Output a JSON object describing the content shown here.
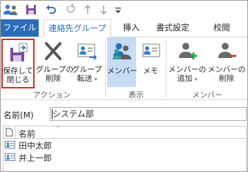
{
  "tabs": {
    "file": "ファイル",
    "contact_group": "連絡先グループ",
    "insert": "挿入",
    "format": "書式設定",
    "review": "校閲"
  },
  "ribbon": {
    "save_close_line1": "保存して",
    "save_close_line2": "閉じる",
    "delete_group_line1": "グループの",
    "delete_group_line2": "削除",
    "forward_group_line1": "グループ",
    "forward_group_line2": "転送",
    "members": "メンバー",
    "notes": "メモ",
    "add_members_line1": "メンバーの",
    "add_members_line2": "追加",
    "remove_member_line1": "メンバーの",
    "remove_member_line2": "削除",
    "group_actions": "アクション",
    "group_show": "表示",
    "group_members": "メンバー"
  },
  "name_field": {
    "label": "名前(M)",
    "value": "システム部"
  },
  "member_list": {
    "column_header": "名前",
    "rows": [
      "田中太郎",
      "井上一郎"
    ]
  },
  "colors": {
    "accent": "#2b6cb8",
    "highlight": "#c6dcf4",
    "save_border": "#e0221d"
  }
}
